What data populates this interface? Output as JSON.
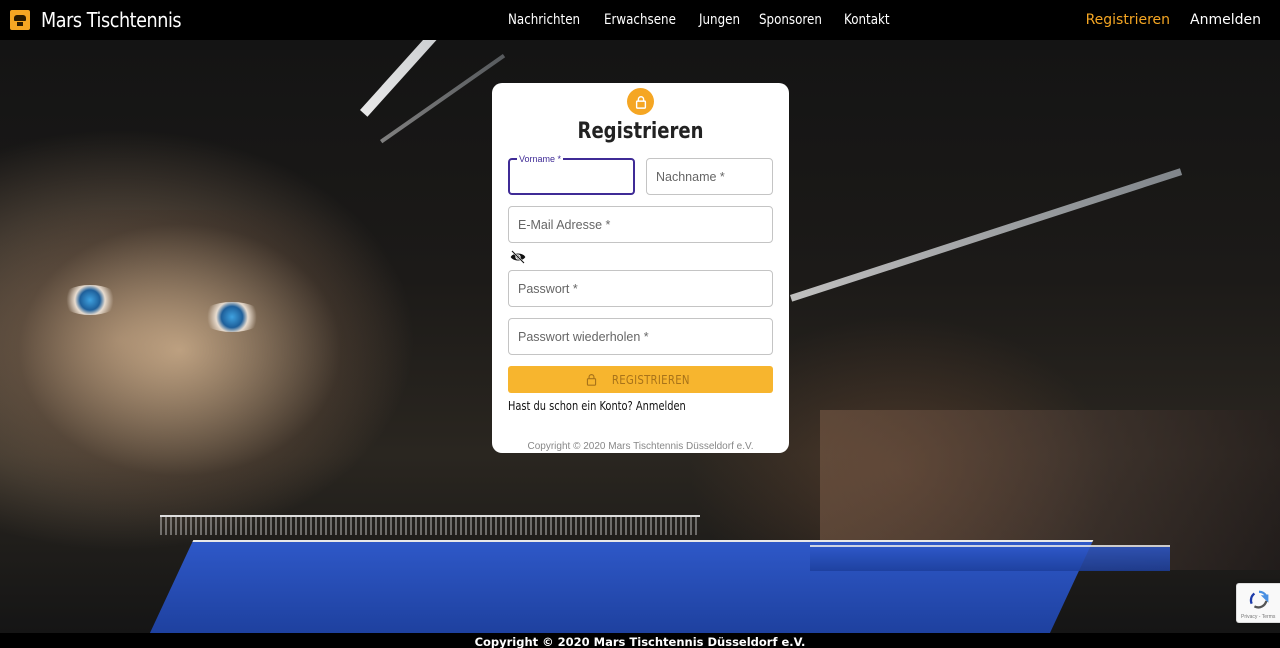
{
  "brand": {
    "name": "Mars Tischtennis",
    "logo_icon": "club-logo-icon",
    "accent": "#f5a623"
  },
  "nav": {
    "links": [
      {
        "label": "Nachrichten"
      },
      {
        "label": "Erwachsene"
      },
      {
        "label": "Jungen"
      },
      {
        "label": "Sponsoren"
      },
      {
        "label": "Kontakt"
      }
    ],
    "register": "Registrieren",
    "login": "Anmelden"
  },
  "form": {
    "title": "Registrieren",
    "lock_icon": "lock-icon",
    "firstname": {
      "label": "Vorname *",
      "value": ""
    },
    "lastname": {
      "placeholder": "Nachname *",
      "value": ""
    },
    "email": {
      "placeholder": "E-Mail Adresse *",
      "value": ""
    },
    "visibility_icon": "eye-off-icon",
    "password": {
      "placeholder": "Passwort *",
      "value": ""
    },
    "password_repeat": {
      "placeholder": "Passwort wiederholen *",
      "value": ""
    },
    "submit_label": "REGISTRIEREN",
    "have_account": "Hast du schon ein Konto? Anmelden",
    "copyright": "Copyright © 2020  Mars Tischtennis Düsseldorf e.V."
  },
  "footer": {
    "copyright": "Copyright © 2020  Mars Tischtennis Düsseldorf e.V."
  },
  "recaptcha": {
    "label": "Privacy - Terms"
  }
}
